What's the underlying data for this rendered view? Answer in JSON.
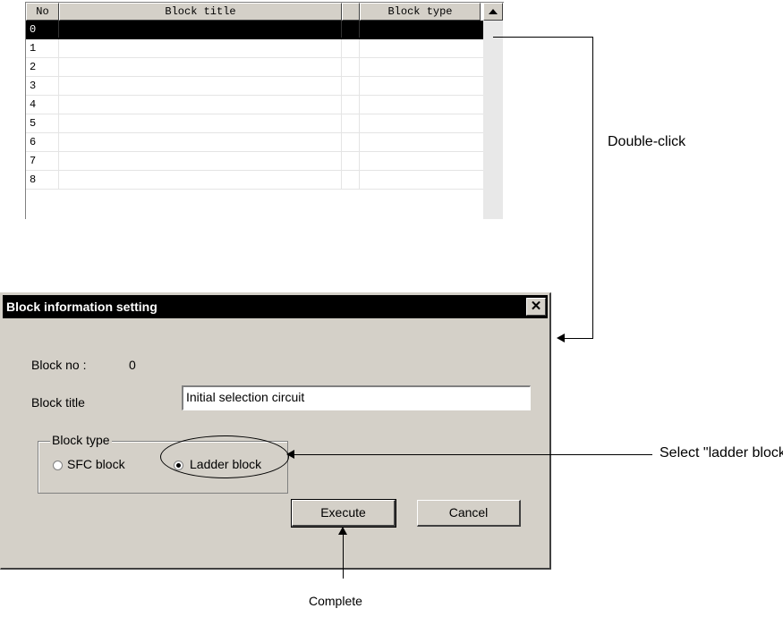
{
  "block_list": {
    "headers": {
      "no": "No",
      "title": "Block title",
      "type": "Block type"
    },
    "rows": [
      {
        "no": "0",
        "title": "",
        "type": ""
      },
      {
        "no": "1",
        "title": "",
        "type": ""
      },
      {
        "no": "2",
        "title": "",
        "type": ""
      },
      {
        "no": "3",
        "title": "",
        "type": ""
      },
      {
        "no": "4",
        "title": "",
        "type": ""
      },
      {
        "no": "5",
        "title": "",
        "type": ""
      },
      {
        "no": "6",
        "title": "",
        "type": ""
      },
      {
        "no": "7",
        "title": "",
        "type": ""
      },
      {
        "no": "8",
        "title": "",
        "type": ""
      }
    ],
    "selected_row": "0"
  },
  "dialog": {
    "title": "Block information setting",
    "block_no_label": "Block no :",
    "block_no_value": "0",
    "block_title_label": "Block title",
    "block_title_value": "Initial selection circuit",
    "block_type_legend": "Block type",
    "options": [
      {
        "label": "SFC block",
        "checked": false
      },
      {
        "label": "Ladder block",
        "checked": true
      }
    ],
    "execute_label": "Execute",
    "cancel_label": "Cancel"
  },
  "annotations": {
    "double_click": "Double-click",
    "select_ladder": "Select \"ladder block\".",
    "complete": "Complete"
  }
}
